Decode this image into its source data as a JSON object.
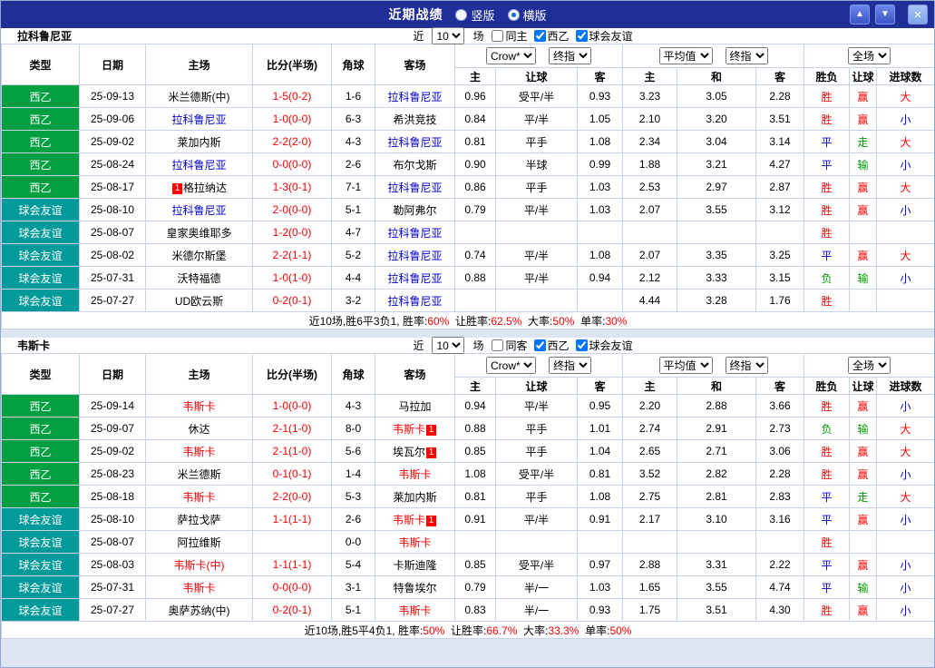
{
  "topbar": {
    "title": "近期战绩",
    "vertical_label": "竖版",
    "horizontal_label": "横版",
    "selected_layout": "横版"
  },
  "icons": {
    "up_arrow": "▲",
    "down_arrow": "▼",
    "close": "×"
  },
  "filter_labels": {
    "near": "近",
    "count": "10",
    "matches": "场"
  },
  "table_headers": {
    "type": "类型",
    "date": "日期",
    "home": "主场",
    "score": "比分(半场)",
    "corner": "角球",
    "away": "客场",
    "odds_group": {
      "select1": "Crow*",
      "select2": "终指",
      "sub": [
        "主",
        "让球",
        "客"
      ]
    },
    "avg_group": {
      "select1": "平均值",
      "select2": "终指",
      "sub": [
        "主",
        "和",
        "客"
      ]
    },
    "result_group": {
      "select1": "全场",
      "sub": [
        "胜负",
        "让球",
        "进球数"
      ]
    }
  },
  "colors": {
    "titlebar": "#202e97",
    "league_green": "#00a040",
    "friendly_teal": "#009a9a",
    "red": "#ff0000",
    "blue": "#0000cc",
    "green": "#009900"
  },
  "sections": [
    {
      "team": "拉科鲁尼亚",
      "filter": {
        "same_label": "同主",
        "same_checked": false,
        "league_label": "西乙",
        "league_checked": true,
        "friendly_label": "球会友谊",
        "friendly_checked": true
      },
      "rows": [
        {
          "type": "西乙",
          "type_style": "green",
          "date": "25-09-13",
          "home": {
            "text": "米兰德斯(中)",
            "color": "black"
          },
          "score": "1-5(0-2)",
          "corner": "1-6",
          "away": {
            "text": "拉科鲁尼亚",
            "color": "blue"
          },
          "odds": [
            "0.96",
            "受平/半",
            "0.93"
          ],
          "avg": [
            "3.23",
            "3.05",
            "2.28"
          ],
          "results": [
            [
              "胜",
              "red"
            ],
            [
              "赢",
              "red"
            ],
            [
              "大",
              "red"
            ]
          ]
        },
        {
          "type": "西乙",
          "type_style": "green",
          "date": "25-09-06",
          "home": {
            "text": "拉科鲁尼亚",
            "color": "blue"
          },
          "score": "1-0(0-0)",
          "corner": "6-3",
          "away": {
            "text": "希洪竞技",
            "color": "black"
          },
          "odds": [
            "0.84",
            "平/半",
            "1.05"
          ],
          "avg": [
            "2.10",
            "3.20",
            "3.51"
          ],
          "results": [
            [
              "胜",
              "red"
            ],
            [
              "赢",
              "red"
            ],
            [
              "小",
              "blue"
            ]
          ]
        },
        {
          "type": "西乙",
          "type_style": "green",
          "date": "25-09-02",
          "home": {
            "text": "莱加内斯",
            "color": "black"
          },
          "score": "2-2(2-0)",
          "corner": "4-3",
          "away": {
            "text": "拉科鲁尼亚",
            "color": "blue"
          },
          "odds": [
            "0.81",
            "平手",
            "1.08"
          ],
          "avg": [
            "2.34",
            "3.04",
            "3.14"
          ],
          "results": [
            [
              "平",
              "blue"
            ],
            [
              "走",
              "green"
            ],
            [
              "大",
              "red"
            ]
          ]
        },
        {
          "type": "西乙",
          "type_style": "green",
          "date": "25-08-24",
          "home": {
            "text": "拉科鲁尼亚",
            "color": "blue"
          },
          "score": "0-0(0-0)",
          "corner": "2-6",
          "away": {
            "text": "布尔戈斯",
            "color": "black"
          },
          "odds": [
            "0.90",
            "半球",
            "0.99"
          ],
          "avg": [
            "1.88",
            "3.21",
            "4.27"
          ],
          "results": [
            [
              "平",
              "blue"
            ],
            [
              "输",
              "green"
            ],
            [
              "小",
              "blue"
            ]
          ]
        },
        {
          "type": "西乙",
          "type_style": "green",
          "date": "25-08-17",
          "home": {
            "text": "格拉纳达",
            "color": "black",
            "badge": "1",
            "badge_pos": "before"
          },
          "score": "1-3(0-1)",
          "corner": "7-1",
          "away": {
            "text": "拉科鲁尼亚",
            "color": "blue"
          },
          "odds": [
            "0.86",
            "平手",
            "1.03"
          ],
          "avg": [
            "2.53",
            "2.97",
            "2.87"
          ],
          "results": [
            [
              "胜",
              "red"
            ],
            [
              "赢",
              "red"
            ],
            [
              "大",
              "red"
            ]
          ]
        },
        {
          "type": "球会友谊",
          "type_style": "teal",
          "date": "25-08-10",
          "home": {
            "text": "拉科鲁尼亚",
            "color": "blue"
          },
          "score": "2-0(0-0)",
          "corner": "5-1",
          "away": {
            "text": "勒阿弗尔",
            "color": "black"
          },
          "odds": [
            "0.79",
            "平/半",
            "1.03"
          ],
          "avg": [
            "2.07",
            "3.55",
            "3.12"
          ],
          "results": [
            [
              "胜",
              "red"
            ],
            [
              "赢",
              "red"
            ],
            [
              "小",
              "blue"
            ]
          ]
        },
        {
          "type": "球会友谊",
          "type_style": "teal",
          "date": "25-08-07",
          "home": {
            "text": "皇家奥维耶多",
            "color": "black"
          },
          "score": "1-2(0-0)",
          "corner": "4-7",
          "away": {
            "text": "拉科鲁尼亚",
            "color": "blue"
          },
          "odds": [
            "",
            "",
            ""
          ],
          "avg": [
            "",
            "",
            ""
          ],
          "results": [
            [
              "胜",
              "red"
            ],
            [
              "",
              "black"
            ],
            [
              "",
              "black"
            ]
          ]
        },
        {
          "type": "球会友谊",
          "type_style": "teal",
          "date": "25-08-02",
          "home": {
            "text": "米德尔斯堡",
            "color": "black"
          },
          "score": "2-2(1-1)",
          "corner": "5-2",
          "away": {
            "text": "拉科鲁尼亚",
            "color": "blue"
          },
          "odds": [
            "0.74",
            "平/半",
            "1.08"
          ],
          "avg": [
            "2.07",
            "3.35",
            "3.25"
          ],
          "results": [
            [
              "平",
              "blue"
            ],
            [
              "赢",
              "red"
            ],
            [
              "大",
              "red"
            ]
          ]
        },
        {
          "type": "球会友谊",
          "type_style": "teal",
          "date": "25-07-31",
          "home": {
            "text": "沃特福德",
            "color": "black"
          },
          "score": "1-0(1-0)",
          "corner": "4-4",
          "away": {
            "text": "拉科鲁尼亚",
            "color": "blue"
          },
          "odds": [
            "0.88",
            "平/半",
            "0.94"
          ],
          "avg": [
            "2.12",
            "3.33",
            "3.15"
          ],
          "results": [
            [
              "负",
              "green"
            ],
            [
              "输",
              "green"
            ],
            [
              "小",
              "blue"
            ]
          ]
        },
        {
          "type": "球会友谊",
          "type_style": "teal",
          "date": "25-07-27",
          "home": {
            "text": "UD欧云斯",
            "color": "black"
          },
          "score": "0-2(0-1)",
          "corner": "3-2",
          "away": {
            "text": "拉科鲁尼亚",
            "color": "blue"
          },
          "odds": [
            "",
            "",
            ""
          ],
          "avg": [
            "4.44",
            "3.28",
            "1.76"
          ],
          "results": [
            [
              "胜",
              "red"
            ],
            [
              "",
              "black"
            ],
            [
              "",
              "black"
            ]
          ]
        }
      ],
      "summary": [
        [
          "近10场,胜6平3负1, 胜率:",
          "black"
        ],
        [
          "60%",
          "red"
        ],
        [
          "  让胜率:",
          "black"
        ],
        [
          "62.5%",
          "red"
        ],
        [
          "  大率:",
          "black"
        ],
        [
          "50%",
          "red"
        ],
        [
          "  单率:",
          "black"
        ],
        [
          "30%",
          "red"
        ]
      ]
    },
    {
      "team": "韦斯卡",
      "filter": {
        "same_label": "同客",
        "same_checked": false,
        "league_label": "西乙",
        "league_checked": true,
        "friendly_label": "球会友谊",
        "friendly_checked": true
      },
      "rows": [
        {
          "type": "西乙",
          "type_style": "green",
          "date": "25-09-14",
          "home": {
            "text": "韦斯卡",
            "color": "red"
          },
          "score": "1-0(0-0)",
          "corner": "4-3",
          "away": {
            "text": "马拉加",
            "color": "black"
          },
          "odds": [
            "0.94",
            "平/半",
            "0.95"
          ],
          "avg": [
            "2.20",
            "2.88",
            "3.66"
          ],
          "results": [
            [
              "胜",
              "red"
            ],
            [
              "赢",
              "red"
            ],
            [
              "小",
              "blue"
            ]
          ]
        },
        {
          "type": "西乙",
          "type_style": "green",
          "date": "25-09-07",
          "home": {
            "text": "休达",
            "color": "black"
          },
          "score": "2-1(1-0)",
          "corner": "8-0",
          "away": {
            "text": "韦斯卡",
            "color": "red",
            "badge": "1",
            "badge_pos": "after"
          },
          "odds": [
            "0.88",
            "平手",
            "1.01"
          ],
          "avg": [
            "2.74",
            "2.91",
            "2.73"
          ],
          "results": [
            [
              "负",
              "green"
            ],
            [
              "输",
              "green"
            ],
            [
              "大",
              "red"
            ]
          ]
        },
        {
          "type": "西乙",
          "type_style": "green",
          "date": "25-09-02",
          "home": {
            "text": "韦斯卡",
            "color": "red"
          },
          "score": "2-1(1-0)",
          "corner": "5-6",
          "away": {
            "text": "埃瓦尔",
            "color": "black",
            "badge": "1",
            "badge_pos": "after"
          },
          "odds": [
            "0.85",
            "平手",
            "1.04"
          ],
          "avg": [
            "2.65",
            "2.71",
            "3.06"
          ],
          "results": [
            [
              "胜",
              "red"
            ],
            [
              "赢",
              "red"
            ],
            [
              "大",
              "red"
            ]
          ]
        },
        {
          "type": "西乙",
          "type_style": "green",
          "date": "25-08-23",
          "home": {
            "text": "米兰德斯",
            "color": "black"
          },
          "score": "0-1(0-1)",
          "corner": "1-4",
          "away": {
            "text": "韦斯卡",
            "color": "red"
          },
          "odds": [
            "1.08",
            "受平/半",
            "0.81"
          ],
          "avg": [
            "3.52",
            "2.82",
            "2.28"
          ],
          "results": [
            [
              "胜",
              "red"
            ],
            [
              "赢",
              "red"
            ],
            [
              "小",
              "blue"
            ]
          ]
        },
        {
          "type": "西乙",
          "type_style": "green",
          "date": "25-08-18",
          "home": {
            "text": "韦斯卡",
            "color": "red"
          },
          "score": "2-2(0-0)",
          "corner": "5-3",
          "away": {
            "text": "莱加内斯",
            "color": "black"
          },
          "odds": [
            "0.81",
            "平手",
            "1.08"
          ],
          "avg": [
            "2.75",
            "2.81",
            "2.83"
          ],
          "results": [
            [
              "平",
              "blue"
            ],
            [
              "走",
              "green"
            ],
            [
              "大",
              "red"
            ]
          ]
        },
        {
          "type": "球会友谊",
          "type_style": "teal",
          "date": "25-08-10",
          "home": {
            "text": "萨拉戈萨",
            "color": "black"
          },
          "score": "1-1(1-1)",
          "corner": "2-6",
          "away": {
            "text": "韦斯卡",
            "color": "red",
            "badge": "1",
            "badge_pos": "after"
          },
          "odds": [
            "0.91",
            "平/半",
            "0.91"
          ],
          "avg": [
            "2.17",
            "3.10",
            "3.16"
          ],
          "results": [
            [
              "平",
              "blue"
            ],
            [
              "赢",
              "red"
            ],
            [
              "小",
              "blue"
            ]
          ]
        },
        {
          "type": "球会友谊",
          "type_style": "teal",
          "date": "25-08-07",
          "home": {
            "text": "阿拉维斯",
            "color": "black"
          },
          "score": "",
          "corner": "0-0",
          "away": {
            "text": "韦斯卡",
            "color": "red"
          },
          "odds": [
            "",
            "",
            ""
          ],
          "avg": [
            "",
            "",
            ""
          ],
          "results": [
            [
              "胜",
              "red"
            ],
            [
              "",
              "black"
            ],
            [
              "",
              "black"
            ]
          ]
        },
        {
          "type": "球会友谊",
          "type_style": "teal",
          "date": "25-08-03",
          "home": {
            "text": "韦斯卡(中)",
            "color": "red"
          },
          "score": "1-1(1-1)",
          "corner": "5-4",
          "away": {
            "text": "卡斯迪隆",
            "color": "black"
          },
          "odds": [
            "0.85",
            "受平/半",
            "0.97"
          ],
          "avg": [
            "2.88",
            "3.31",
            "2.22"
          ],
          "results": [
            [
              "平",
              "blue"
            ],
            [
              "赢",
              "red"
            ],
            [
              "小",
              "blue"
            ]
          ]
        },
        {
          "type": "球会友谊",
          "type_style": "teal",
          "date": "25-07-31",
          "home": {
            "text": "韦斯卡",
            "color": "red"
          },
          "score": "0-0(0-0)",
          "corner": "3-1",
          "away": {
            "text": "特鲁埃尔",
            "color": "black"
          },
          "odds": [
            "0.79",
            "半/一",
            "1.03"
          ],
          "avg": [
            "1.65",
            "3.55",
            "4.74"
          ],
          "results": [
            [
              "平",
              "blue"
            ],
            [
              "输",
              "green"
            ],
            [
              "小",
              "blue"
            ]
          ]
        },
        {
          "type": "球会友谊",
          "type_style": "teal",
          "date": "25-07-27",
          "home": {
            "text": "奥萨苏纳(中)",
            "color": "black"
          },
          "score": "0-2(0-1)",
          "corner": "5-1",
          "away": {
            "text": "韦斯卡",
            "color": "red"
          },
          "odds": [
            "0.83",
            "半/一",
            "0.93"
          ],
          "avg": [
            "1.75",
            "3.51",
            "4.30"
          ],
          "results": [
            [
              "胜",
              "red"
            ],
            [
              "赢",
              "red"
            ],
            [
              "小",
              "blue"
            ]
          ]
        }
      ],
      "summary": [
        [
          "近10场,胜5平4负1, 胜率:",
          "black"
        ],
        [
          "50%",
          "red"
        ],
        [
          "  让胜率:",
          "black"
        ],
        [
          "66.7%",
          "red"
        ],
        [
          "  大率:",
          "black"
        ],
        [
          "33.3%",
          "red"
        ],
        [
          "  单率:",
          "black"
        ],
        [
          "50%",
          "red"
        ]
      ]
    }
  ]
}
